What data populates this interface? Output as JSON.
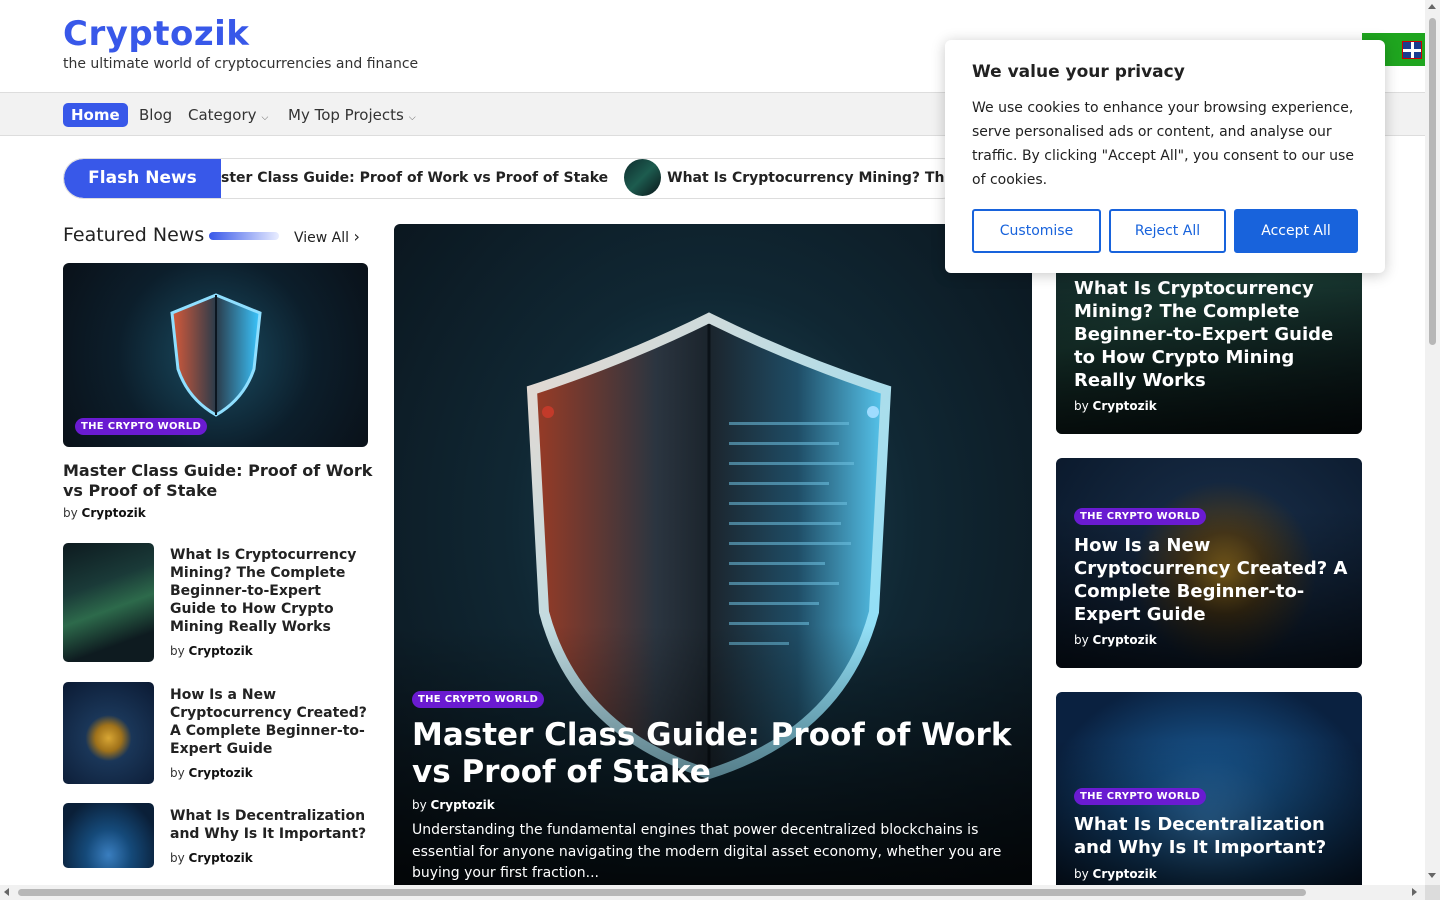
{
  "site": {
    "title": "Cryptozik",
    "tagline": "the ultimate world of cryptocurrencies and finance"
  },
  "nav": {
    "items": [
      {
        "label": "Home",
        "active": true
      },
      {
        "label": "Blog"
      },
      {
        "label": "Category",
        "dropdown": true
      },
      {
        "label": "My Top Projects",
        "dropdown": true
      }
    ]
  },
  "flash_news": {
    "label": "Flash News",
    "items": [
      "ster Class Guide: Proof of Work vs Proof of Stake",
      "What Is Cryptocurrency Mining? The Comple"
    ]
  },
  "featured": {
    "section_title": "Featured News",
    "view_all": "View All",
    "main": {
      "badge": "THE CRYPTO WORLD",
      "title": "Master Class Guide: Proof of Work vs Proof of Stake",
      "by": "by",
      "author": "Cryptozik"
    },
    "list": [
      {
        "title": "What Is Cryptocurrency Mining? The Complete Beginner-to-Expert Guide to How Crypto Mining Really Works",
        "by": "by",
        "author": "Cryptozik"
      },
      {
        "title": "How Is a New Cryptocurrency Created? A Complete Beginner-to-Expert Guide",
        "by": "by",
        "author": "Cryptozik"
      },
      {
        "title": "What Is Decentralization and Why Is It Important?",
        "by": "by",
        "author": "Cryptozik"
      }
    ]
  },
  "hero": {
    "badge": "THE CRYPTO WORLD",
    "title": "Master Class Guide: Proof of Work vs Proof of Stake",
    "by": "by",
    "author": "Cryptozik",
    "excerpt": "Understanding the fundamental engines that power decentralized blockchains is essential for anyone navigating the modern digital asset economy, whether you are buying your first fraction..."
  },
  "side_cards": [
    {
      "title": "What Is Cryptocurrency Mining? The Complete Beginner-to-Expert Guide to How Crypto Mining Really Works",
      "by": "by",
      "author": "Cryptozik"
    },
    {
      "badge": "THE CRYPTO WORLD",
      "title": "How Is a New Cryptocurrency Created? A Complete Beginner-to-Expert Guide",
      "by": "by",
      "author": "Cryptozik"
    },
    {
      "badge": "THE CRYPTO WORLD",
      "title": "What Is Decentralization and Why Is It Important?",
      "by": "by",
      "author": "Cryptozik"
    }
  ],
  "cookie": {
    "title": "We value your privacy",
    "text": "We use cookies to enhance your browsing experience, serve personalised ads or content, and analyse our traffic. By clicking \"Accept All\", you consent to our use of cookies.",
    "customise": "Customise",
    "reject": "Reject All",
    "accept": "Accept All"
  },
  "colors": {
    "brand": "#3858e9",
    "badge": "#6a1bd1",
    "cookie_button": "#1863dc"
  }
}
